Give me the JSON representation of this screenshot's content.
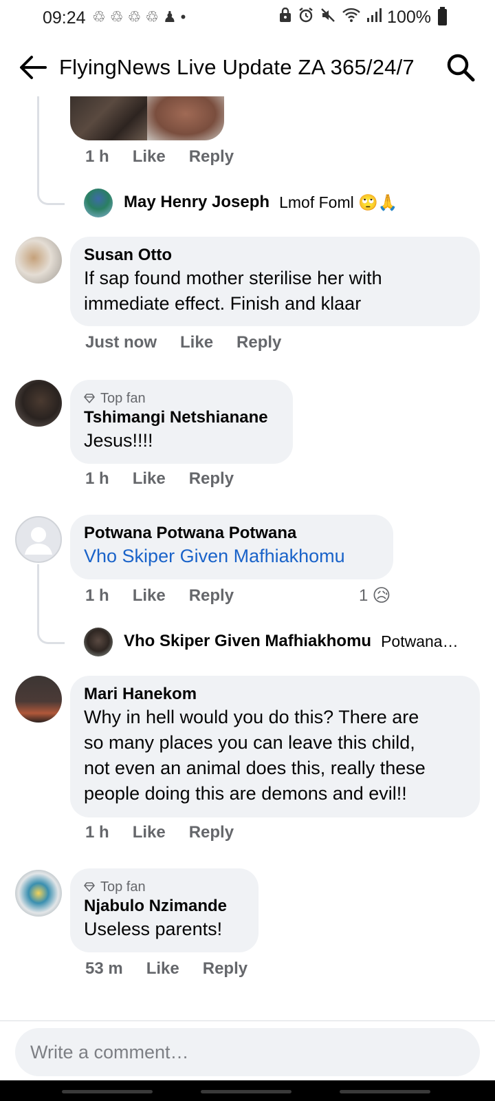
{
  "status_bar": {
    "time": "09:24",
    "dot": "•",
    "battery": "100%"
  },
  "header": {
    "title": "FlyingNews Live Update ZA 365/24/7"
  },
  "comments": [
    {
      "actions": {
        "time": "1 h",
        "like": "Like",
        "reply": "Reply"
      },
      "reply_preview": {
        "name": "May Henry Joseph",
        "text": "Lmof Foml 🙄🙏"
      }
    },
    {
      "author": "Susan Otto",
      "text_lines": [
        "If sap found mother sterilise her with",
        "immediate effect. Finish and klaar"
      ],
      "actions": {
        "time": "Just now",
        "like": "Like",
        "reply": "Reply"
      }
    },
    {
      "badge": "Top fan",
      "author": "Tshimangi Netshianane",
      "text": "Jesus!!!!",
      "actions": {
        "time": "1 h",
        "like": "Like",
        "reply": "Reply"
      }
    },
    {
      "author": "Potwana Potwana Potwana",
      "link_text": "Vho Skiper Given Mafhiakhomu",
      "actions": {
        "time": "1 h",
        "like": "Like",
        "reply": "Reply"
      },
      "reaction": {
        "count": "1",
        "emoji": "😥"
      },
      "reply_preview": {
        "name": "Vho Skiper Given Mafhiakhomu",
        "text": "Potwana…"
      }
    },
    {
      "author": "Mari Hanekom",
      "text_lines": [
        "Why in hell would you do this? There are",
        "so many places you can leave this child,",
        "not even an animal does this, really these",
        "people doing this are demons and evil!!"
      ],
      "actions": {
        "time": "1 h",
        "like": "Like",
        "reply": "Reply"
      }
    },
    {
      "badge": "Top fan",
      "author": "Njabulo Nzimande",
      "text": "Useless parents!",
      "actions": {
        "time": "53 m",
        "like": "Like",
        "reply": "Reply"
      }
    }
  ],
  "composer": {
    "placeholder": "Write a comment…"
  },
  "icons": {
    "back": "arrow-left-icon",
    "search": "search-icon",
    "badge": "diamond-icon"
  },
  "colors": {
    "bubble": "#f0f2f5",
    "link": "#1a63c9",
    "secondary_text": "#65676b"
  }
}
